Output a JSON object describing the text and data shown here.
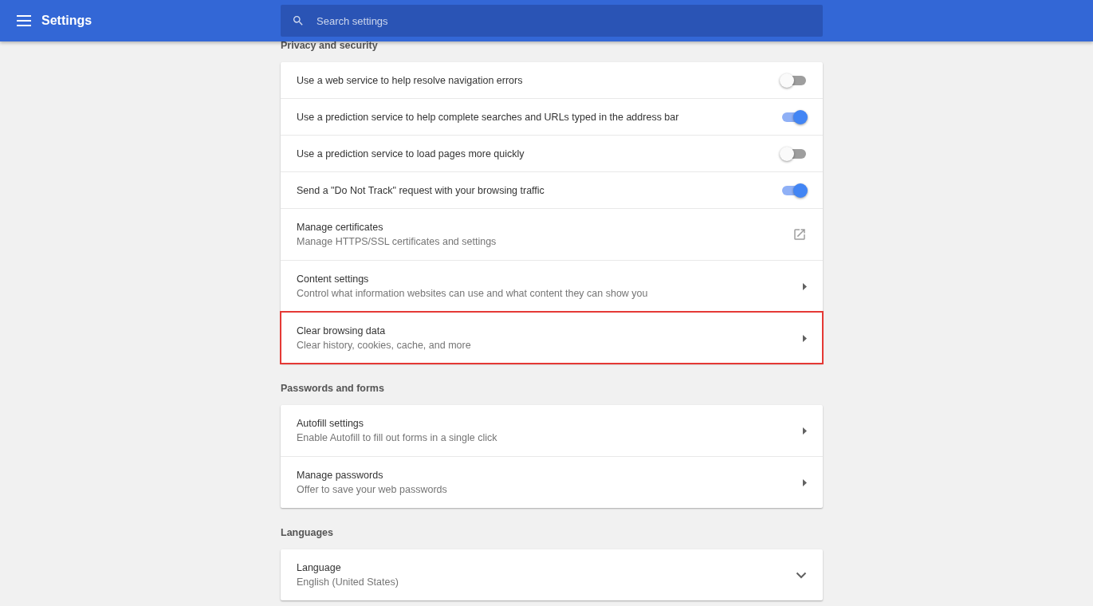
{
  "header": {
    "title": "Settings",
    "search": {
      "placeholder": "Search settings"
    }
  },
  "sections": [
    {
      "heading": "Privacy and security",
      "rows": [
        {
          "kind": "toggle",
          "label": "Use a web service to help resolve navigation errors",
          "on": false
        },
        {
          "kind": "toggle",
          "label": "Use a prediction service to help complete searches and URLs typed in the address bar",
          "on": true
        },
        {
          "kind": "toggle",
          "label": "Use a prediction service to load pages more quickly",
          "on": false
        },
        {
          "kind": "toggle",
          "label": "Send a \"Do Not Track\" request with your browsing traffic",
          "on": true
        },
        {
          "kind": "external",
          "label": "Manage certificates",
          "sublabel": "Manage HTTPS/SSL certificates and settings",
          "highlighted": false
        },
        {
          "kind": "arrow",
          "label": "Content settings",
          "sublabel": "Control what information websites can use and what content they can show you",
          "highlighted": false
        },
        {
          "kind": "arrow",
          "label": "Clear browsing data",
          "sublabel": "Clear history, cookies, cache, and more",
          "highlighted": true
        }
      ]
    },
    {
      "heading": "Passwords and forms",
      "rows": [
        {
          "kind": "arrow",
          "label": "Autofill settings",
          "sublabel": "Enable Autofill to fill out forms in a single click",
          "highlighted": false
        },
        {
          "kind": "arrow",
          "label": "Manage passwords",
          "sublabel": "Offer to save your web passwords",
          "highlighted": false
        }
      ]
    },
    {
      "heading": "Languages",
      "rows": [
        {
          "kind": "expand",
          "label": "Language",
          "sublabel": "English (United States)",
          "highlighted": false
        }
      ]
    }
  ]
}
